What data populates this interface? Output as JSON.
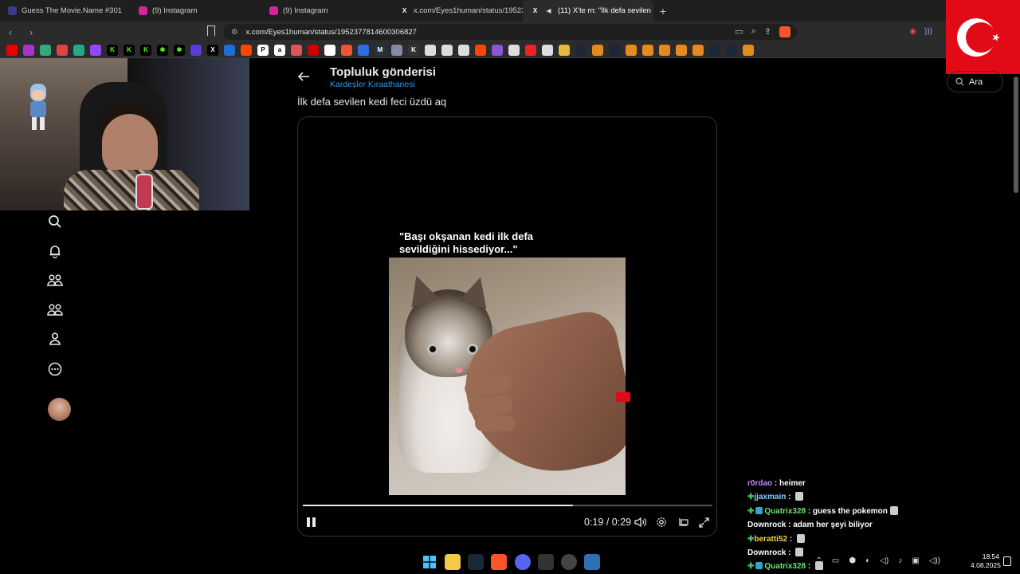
{
  "tabs": [
    {
      "label": "Guess The Movie.Name #301",
      "icon_color": "#3b3b8a"
    },
    {
      "label": "(9) Instagram",
      "icon_color": "#d6249f"
    },
    {
      "label": "(9) Instagram",
      "icon_color": "#d6249f"
    },
    {
      "label": "x.com/Eyes1human/status/1952377814...",
      "icon_color": "#000000"
    },
    {
      "label": "(11) X'te m: \"İlk defa sevilen k...",
      "icon_color": "#000000",
      "active": true
    }
  ],
  "address": {
    "url": "x.com/Eyes1human/status/1952377814600306827"
  },
  "post": {
    "header_title": "Topluluk gönderisi",
    "community": "Kardeşler Kıraathanesi",
    "text": "İlk defa sevilen kedi feci üzdü aq",
    "video_caption_line1": "\"Başı okşanan kedi ilk defa",
    "video_caption_line2": "sevildiğini hissediyor...\"",
    "time_current": "0:19",
    "time_separator": "/",
    "time_total": "0:29",
    "progress_fraction": 0.66
  },
  "search": {
    "placeholder": "Ara"
  },
  "chat": [
    {
      "user": "r0rdao",
      "user_color": "#b78cf2",
      "message": "heimer",
      "plus": false,
      "badge": false,
      "emote": false
    },
    {
      "user": "jjaxmain",
      "user_color": "#7fd3ff",
      "message": "",
      "plus": true,
      "badge": false,
      "emote": true
    },
    {
      "user": "Quatrix328",
      "user_color": "#6ee36e",
      "message": "guess the pokemon",
      "plus": true,
      "badge": true,
      "emote": true
    },
    {
      "user": "Downrock",
      "user_color": "#ffffff",
      "message": "adam her şeyi biliyor",
      "plus": false,
      "badge": false,
      "emote": false
    },
    {
      "user": "beratti52",
      "user_color": "#f2d33f",
      "message": "",
      "plus": true,
      "badge": false,
      "emote": true
    },
    {
      "user": "Downrock",
      "user_color": "#ffffff",
      "message": "",
      "plus": false,
      "badge": false,
      "emote": true
    },
    {
      "user": "Quatrix328",
      "user_color": "#6ee36e",
      "message": "",
      "plus": true,
      "badge": true,
      "emote": true
    }
  ],
  "clock": {
    "time": "18:54",
    "date": "4.08.2025"
  },
  "colors": {
    "accent": "#1d9bf0",
    "flag_red": "#e30a17",
    "background": "#000000"
  }
}
